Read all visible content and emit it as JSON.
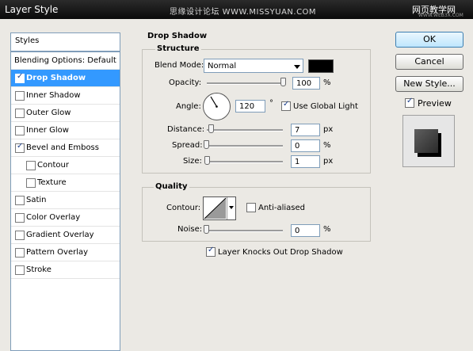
{
  "window": {
    "title": "Layer Style",
    "watermark_center": "思缘设计论坛  WWW.MISSYUAN.COM",
    "watermark_right": "网页教学网",
    "watermark_url": "WWW.WEB3X.COM"
  },
  "sidebar": {
    "header": "Styles",
    "items": [
      {
        "label": "Blending Options: Default",
        "checkbox": false,
        "checked": false,
        "selected": false,
        "indent": 0
      },
      {
        "label": "Drop Shadow",
        "checkbox": true,
        "checked": true,
        "selected": true,
        "indent": 0
      },
      {
        "label": "Inner Shadow",
        "checkbox": true,
        "checked": false,
        "selected": false,
        "indent": 0
      },
      {
        "label": "Outer Glow",
        "checkbox": true,
        "checked": false,
        "selected": false,
        "indent": 0
      },
      {
        "label": "Inner Glow",
        "checkbox": true,
        "checked": false,
        "selected": false,
        "indent": 0
      },
      {
        "label": "Bevel and Emboss",
        "checkbox": true,
        "checked": true,
        "selected": false,
        "indent": 0
      },
      {
        "label": "Contour",
        "checkbox": true,
        "checked": false,
        "selected": false,
        "indent": 1
      },
      {
        "label": "Texture",
        "checkbox": true,
        "checked": false,
        "selected": false,
        "indent": 1
      },
      {
        "label": "Satin",
        "checkbox": true,
        "checked": false,
        "selected": false,
        "indent": 0
      },
      {
        "label": "Color Overlay",
        "checkbox": true,
        "checked": false,
        "selected": false,
        "indent": 0
      },
      {
        "label": "Gradient Overlay",
        "checkbox": true,
        "checked": false,
        "selected": false,
        "indent": 0
      },
      {
        "label": "Pattern Overlay",
        "checkbox": true,
        "checked": false,
        "selected": false,
        "indent": 0
      },
      {
        "label": "Stroke",
        "checkbox": true,
        "checked": false,
        "selected": false,
        "indent": 0
      }
    ]
  },
  "drop_shadow": {
    "section_title": "Drop Shadow",
    "structure": {
      "title": "Structure",
      "blend_mode_label": "Blend Mode:",
      "blend_mode_value": "Normal",
      "shadow_color": "#000000",
      "opacity_label": "Opacity:",
      "opacity_value": "100",
      "opacity_unit": "%",
      "opacity_level": 100,
      "angle_label": "Angle:",
      "angle_value": "120",
      "angle_unit": "°",
      "use_global_light_label": "Use Global Light",
      "use_global_light_checked": true,
      "distance_label": "Distance:",
      "distance_value": "7",
      "distance_unit": "px",
      "spread_label": "Spread:",
      "spread_value": "0",
      "spread_unit": "%",
      "size_label": "Size:",
      "size_value": "1",
      "size_unit": "px"
    },
    "quality": {
      "title": "Quality",
      "contour_label": "Contour:",
      "anti_aliased_label": "Anti-aliased",
      "anti_aliased_checked": false,
      "noise_label": "Noise:",
      "noise_value": "0",
      "noise_unit": "%"
    },
    "knockout_label": "Layer Knocks Out Drop Shadow",
    "knockout_checked": true
  },
  "buttons": {
    "ok": "OK",
    "cancel": "Cancel",
    "new_style": "New Style...",
    "preview_label": "Preview",
    "preview_checked": true
  }
}
